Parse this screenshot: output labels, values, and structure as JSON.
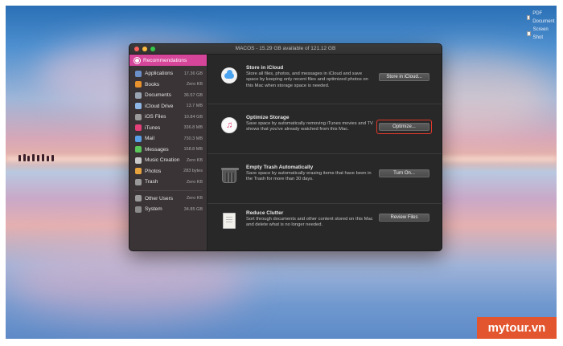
{
  "desktop": {
    "files": [
      "PDF Document",
      "Screen Shot"
    ]
  },
  "window": {
    "title": "MACOS - 15.29 GB available of 121.12 GB"
  },
  "sidebar": {
    "recommendations_label": "Recommendations",
    "items": [
      {
        "label": "Applications",
        "size": "17.36 GB",
        "icon": "applications-icon",
        "color": "#6b8fc7"
      },
      {
        "label": "Books",
        "size": "Zero KB",
        "icon": "books-icon",
        "color": "#e8922e"
      },
      {
        "label": "Documents",
        "size": "36.57 GB",
        "icon": "documents-icon",
        "color": "#9aa5b3"
      },
      {
        "label": "iCloud Drive",
        "size": "13.7 MB",
        "icon": "icloud-drive-icon",
        "color": "#8eb7e6"
      },
      {
        "label": "iOS Files",
        "size": "10.84 GB",
        "icon": "ios-files-icon",
        "color": "#9a9a9a"
      },
      {
        "label": "iTunes",
        "size": "336.8 MB",
        "icon": "itunes-icon",
        "color": "#e4407a"
      },
      {
        "label": "Mail",
        "size": "730.3 MB",
        "icon": "mail-icon",
        "color": "#5aa0e6"
      },
      {
        "label": "Messages",
        "size": "158.8 MB",
        "icon": "messages-icon",
        "color": "#5ac85a"
      },
      {
        "label": "Music Creation",
        "size": "Zero KB",
        "icon": "music-creation-icon",
        "color": "#c9c9c9"
      },
      {
        "label": "Photos",
        "size": "283 bytes",
        "icon": "photos-icon",
        "color": "#e6a33e"
      },
      {
        "label": "Trash",
        "size": "Zero KB",
        "icon": "trash-icon",
        "color": "#9a9a9a"
      }
    ],
    "other_items": [
      {
        "label": "Other Users",
        "size": "Zero KB",
        "icon": "other-users-icon",
        "color": "#9a9a9a"
      },
      {
        "label": "System",
        "size": "34.85 GB",
        "icon": "system-icon",
        "color": "#8a8a8a"
      }
    ]
  },
  "recommendations": [
    {
      "title": "Store in iCloud",
      "description": "Store all files, photos, and messages in iCloud and save space by keeping only recent files and optimized photos on this Mac when storage space is needed.",
      "button": "Store in iCloud..."
    },
    {
      "title": "Optimize Storage",
      "description": "Save space by automatically removing iTunes movies and TV shows that you've already watched from this Mac.",
      "button": "Optimize..."
    },
    {
      "title": "Empty Trash Automatically",
      "description": "Save space by automatically erasing items that have been in the Trash for more than 30 days.",
      "button": "Turn On..."
    },
    {
      "title": "Reduce Clutter",
      "description": "Sort through documents and other content stored on this Mac and delete what is no longer needed.",
      "button": "Review Files"
    }
  ],
  "watermark": "mytour.vn",
  "colors": {
    "accent": "#d5459a",
    "highlight": "#e0382b"
  }
}
